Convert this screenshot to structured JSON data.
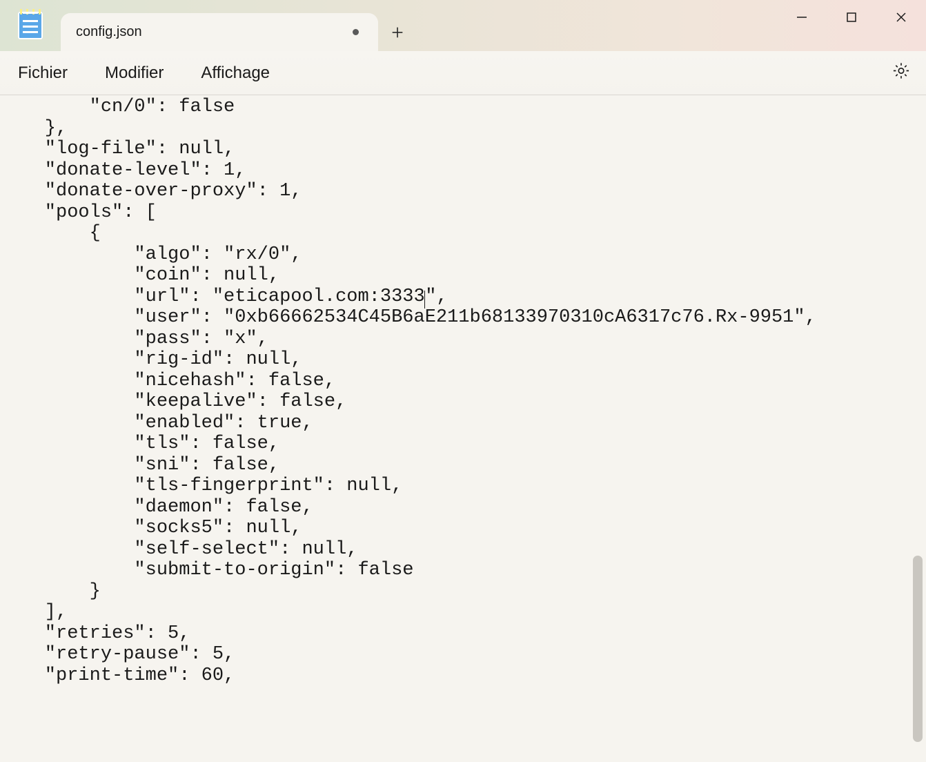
{
  "window": {
    "tab_title": "config.json",
    "unsaved": true
  },
  "menu": {
    "file": "Fichier",
    "edit": "Modifier",
    "view": "Affichage"
  },
  "editor": {
    "lines": [
      "        \"cn/0\": false",
      "    },",
      "    \"log-file\": null,",
      "    \"donate-level\": 1,",
      "    \"donate-over-proxy\": 1,",
      "    \"pools\": [",
      "        {",
      "            \"algo\": \"rx/0\",",
      "            \"coin\": null,",
      "            \"url\": \"eticapool.com:3333|\",",
      "            \"user\": \"0xb66662534C45B6aE211b68133970310cA6317c76.Rx-9951\",",
      "            \"pass\": \"x\",",
      "            \"rig-id\": null,",
      "            \"nicehash\": false,",
      "            \"keepalive\": false,",
      "            \"enabled\": true,",
      "            \"tls\": false,",
      "            \"sni\": false,",
      "            \"tls-fingerprint\": null,",
      "            \"daemon\": false,",
      "            \"socks5\": null,",
      "            \"self-select\": null,",
      "            \"submit-to-origin\": false",
      "        }",
      "    ],",
      "    \"retries\": 5,",
      "    \"retry-pause\": 5,",
      "    \"print-time\": 60,"
    ],
    "caret_line_index": 9,
    "caret_marker": "|"
  },
  "scrollbar": {
    "thumb_top_pct": 69,
    "thumb_height_pct": 28
  }
}
